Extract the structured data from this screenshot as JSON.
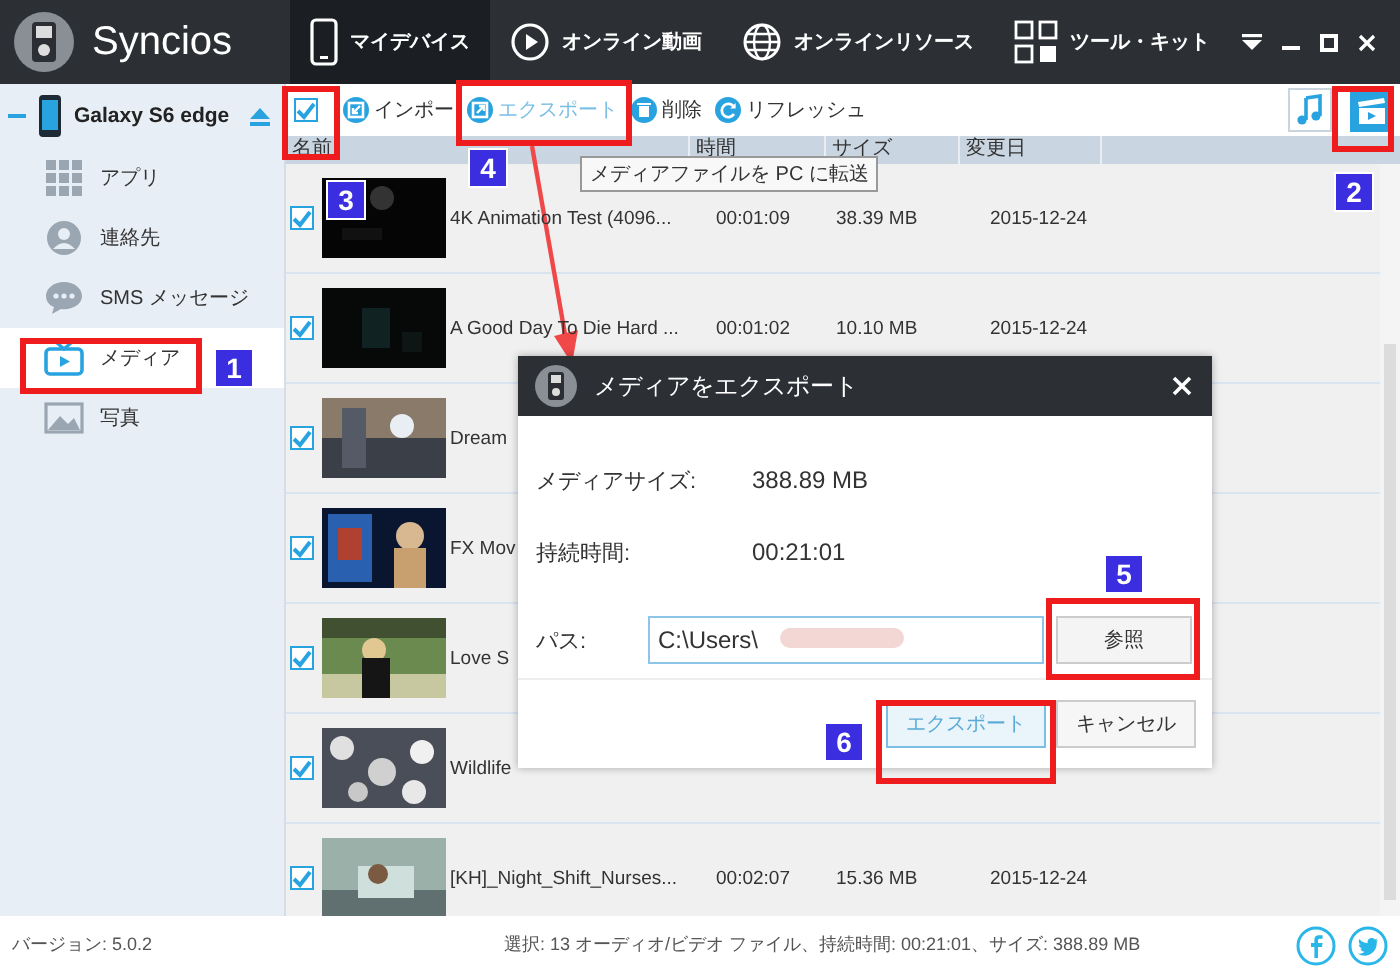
{
  "app": {
    "name": "Syncios"
  },
  "nav_tabs": [
    {
      "label": "マイデバイス",
      "kind": "device",
      "selected": true
    },
    {
      "label": "オンライン動画",
      "kind": "play",
      "selected": false
    },
    {
      "label": "オンラインリソース",
      "kind": "globe",
      "selected": false
    },
    {
      "label": "ツール・キット",
      "kind": "toolkit",
      "selected": false
    }
  ],
  "sidebar": {
    "device": "Galaxy S6 edge",
    "items": [
      {
        "label": "アプリ",
        "kind": "apps",
        "selected": false
      },
      {
        "label": "連絡先",
        "kind": "contacts",
        "selected": false
      },
      {
        "label": "SMS メッセージ",
        "kind": "sms",
        "selected": false
      },
      {
        "label": "メディア",
        "kind": "media",
        "selected": true
      },
      {
        "label": "写真",
        "kind": "photos",
        "selected": false
      }
    ]
  },
  "toolbar": {
    "select_all_checked": true,
    "actions": [
      {
        "label": "インポー",
        "kind": "import"
      },
      {
        "label": "エクスポート",
        "kind": "export"
      },
      {
        "label": "削除",
        "kind": "delete"
      },
      {
        "label": "リフレッシュ",
        "kind": "refresh"
      }
    ],
    "view_toggles": [
      {
        "kind": "music",
        "selected": false
      },
      {
        "kind": "video",
        "selected": true
      }
    ]
  },
  "tooltip": "メディアファイルを PC に転送",
  "table": {
    "columns": [
      "名前",
      "時間",
      "サイズ",
      "変更日"
    ],
    "rows": [
      {
        "checked": true,
        "name": "4K Animation Test (4096...",
        "time": "00:01:09",
        "size": "38.39 MB",
        "date": "2015-12-24"
      },
      {
        "checked": true,
        "name": "A Good Day To Die Hard ...",
        "time": "00:01:02",
        "size": "10.10 MB",
        "date": "2015-12-24"
      },
      {
        "checked": true,
        "name": "Dream"
      },
      {
        "checked": true,
        "name": "FX Mov"
      },
      {
        "checked": true,
        "name": "Love S"
      },
      {
        "checked": true,
        "name": "Wildlife"
      },
      {
        "checked": true,
        "name": "[KH]_Night_Shift_Nurses...",
        "time": "00:02:07",
        "size": "15.36 MB",
        "date": "2015-12-24"
      }
    ]
  },
  "dialog": {
    "title": "メディアをエクスポート",
    "fields": [
      {
        "label": "メディアサイズ:",
        "value": "388.89 MB"
      },
      {
        "label": "持続時間:",
        "value": "00:21:01"
      }
    ],
    "path_label": "パス:",
    "path_value": "C:\\Users\\",
    "browse_button": "参照",
    "export_button": "エクスポート",
    "cancel_button": "キャンセル"
  },
  "status_bar": {
    "version": "バージョン: 5.0.2",
    "summary": "選択: 13 オーディオ/ビデオ ファイル、持続時間: 00:21:01、サイズ: 388.89 MB"
  },
  "annotations": [
    "1",
    "2",
    "3",
    "4",
    "5",
    "6"
  ]
}
